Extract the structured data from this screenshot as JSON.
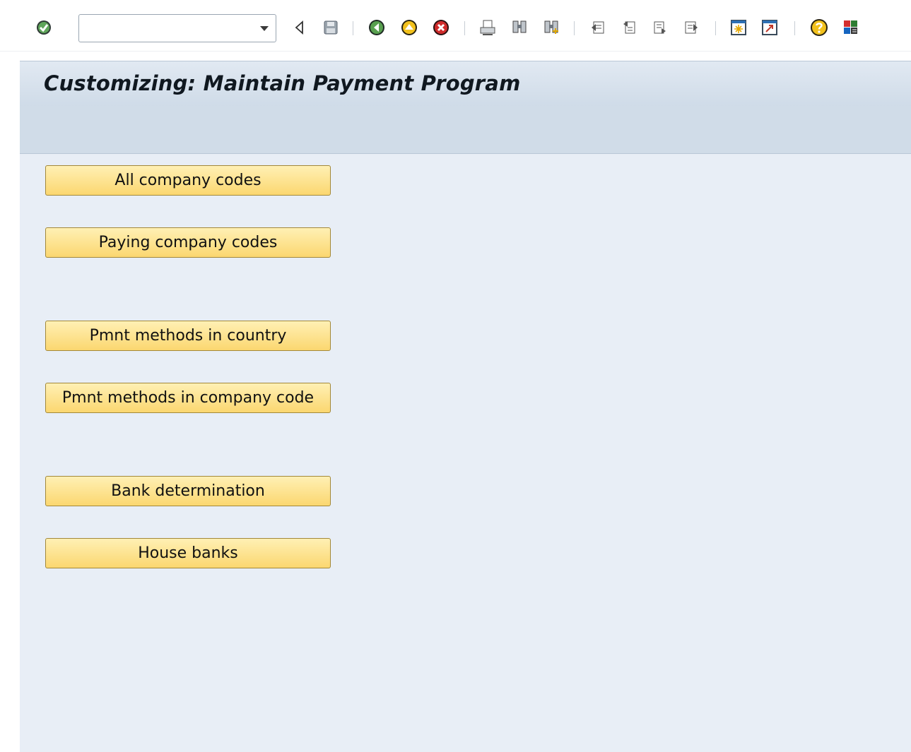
{
  "toolbar": {
    "command_field_value": "",
    "icons": [
      "enter-icon",
      "command-dropdown-icon",
      "collapse-icon",
      "save-icon",
      "back-icon",
      "exit-icon",
      "cancel-icon",
      "print-icon",
      "find-icon",
      "find-next-icon",
      "first-page-icon",
      "previous-page-icon",
      "next-page-icon",
      "last-page-icon",
      "create-session-icon",
      "create-shortcut-icon",
      "help-icon",
      "layout-menu-icon"
    ]
  },
  "page": {
    "title": "Customizing: Maintain Payment Program"
  },
  "buttons": {
    "all_company_codes": "All company codes",
    "paying_company_codes": "Paying company codes",
    "pmnt_methods_country": "Pmnt methods in country",
    "pmnt_methods_company_code": "Pmnt methods in company code",
    "bank_determination": "Bank determination",
    "house_banks": "House banks"
  },
  "colors": {
    "button_gradient_top": "#fff0b4",
    "button_gradient_bottom": "#fbd770",
    "main_background": "#e8eef6",
    "title_bar": "#d6e0eb"
  }
}
